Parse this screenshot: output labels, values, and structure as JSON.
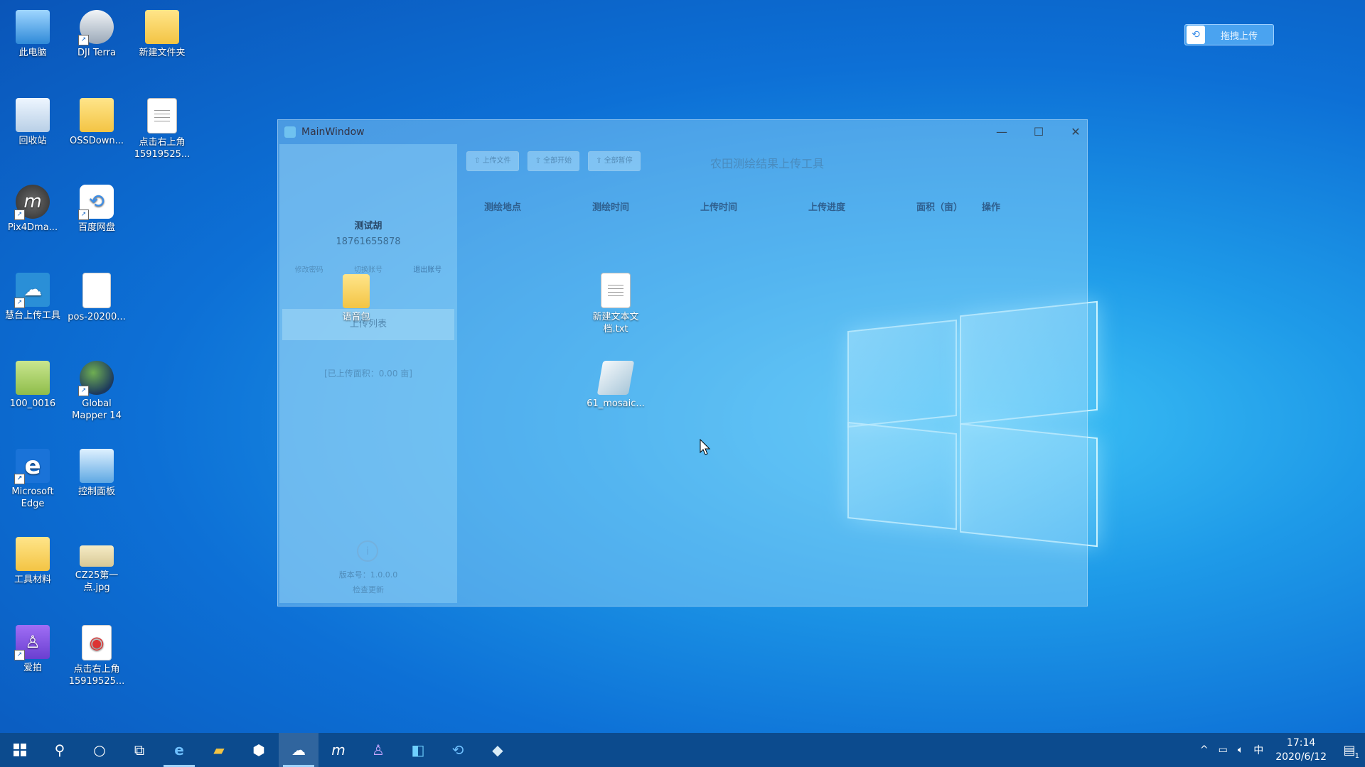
{
  "desktop": {
    "icons": [
      {
        "label": "此电脑",
        "icon": "computer-icon"
      },
      {
        "label": "DJI Terra",
        "icon": "dji-terra-icon"
      },
      {
        "label": "新建文件夹",
        "icon": "folder-icon"
      },
      {
        "label": "回收站",
        "icon": "recycle-bin-icon"
      },
      {
        "label": "OSSDown...",
        "icon": "folder-icon"
      },
      {
        "label": "点击右上角 15919525...",
        "icon": "document-icon"
      },
      {
        "label": "Pix4Dma...",
        "icon": "pix4d-icon"
      },
      {
        "label": "百度网盘",
        "icon": "baidu-netdisk-icon"
      },
      {
        "label": "慧台上传工具",
        "icon": "upload-tool-icon"
      },
      {
        "label": "pos-20200...",
        "icon": "document-icon"
      },
      {
        "label": "100_0016",
        "icon": "folder-icon"
      },
      {
        "label": "Global Mapper 14",
        "icon": "globe-icon"
      },
      {
        "label": "Microsoft Edge",
        "icon": "edge-icon"
      },
      {
        "label": "控制面板",
        "icon": "control-panel-icon"
      },
      {
        "label": "工具材料",
        "icon": "folder-icon"
      },
      {
        "label": "CZ25第一点.jpg",
        "icon": "image-icon"
      },
      {
        "label": "爱拍",
        "icon": "aipai-icon"
      },
      {
        "label": "点击右上角 15919525...",
        "icon": "music-file-icon"
      },
      {
        "label": "语音包",
        "icon": "zip-folder-icon"
      },
      {
        "label": "新建文本文档.txt",
        "icon": "text-file-icon"
      },
      {
        "label": "61_mosaic...",
        "icon": "mosaic-file-icon"
      }
    ]
  },
  "window": {
    "title": "MainWindow",
    "app_title": "农田测绘结果上传工具",
    "toolbar": [
      "上传文件",
      "全部开始",
      "全部暂停"
    ],
    "user": {
      "name": "测试胡",
      "phone": "18761655878"
    },
    "links": [
      "修改密码",
      "切换账号",
      "退出账号"
    ],
    "menu_item": "上传列表",
    "total_area": "[已上传面积：0.00 亩]",
    "version": "版本号：1.0.0.0",
    "check_update": "检查更新",
    "table_headers": [
      "测绘地点",
      "测绘时间",
      "上传时间",
      "上传进度",
      "面积（亩）",
      "操作"
    ]
  },
  "widget": {
    "label": "拖拽上传"
  },
  "taskbar": {
    "input_method": "中",
    "time": "17:14",
    "date": "2020/6/12",
    "notifications": "1"
  },
  "colors": {
    "taskbar": "#0c4b8e",
    "accent": "#4aa3f0"
  }
}
